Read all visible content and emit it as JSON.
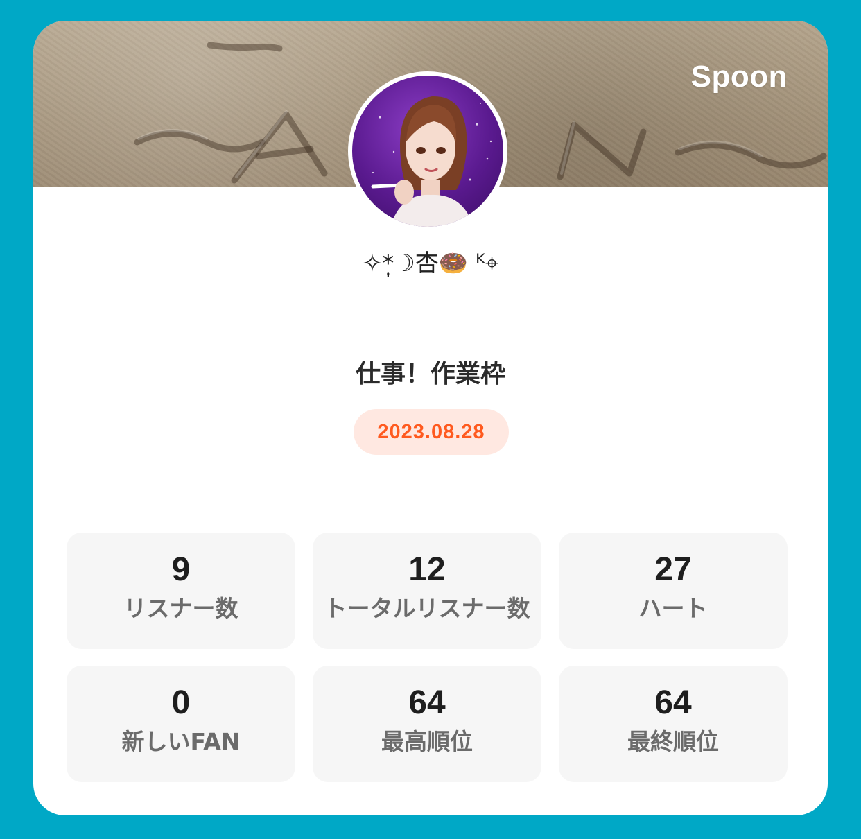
{
  "brand": {
    "name": "Spoon"
  },
  "profile": {
    "username": "✧*̣̩☽杏🍩 ᴷ⌖",
    "avatar_icon": "avatar-illustration"
  },
  "broadcast": {
    "title": "仕事！作業枠",
    "date": "2023.08.28"
  },
  "stats": [
    {
      "value": "9",
      "label": "リスナー数"
    },
    {
      "value": "12",
      "label": "トータルリスナー数"
    },
    {
      "value": "27",
      "label": "ハート"
    },
    {
      "value": "0",
      "label": "新しいFAN"
    },
    {
      "value": "64",
      "label": "最高順位"
    },
    {
      "value": "64",
      "label": "最終順位"
    }
  ],
  "colors": {
    "background": "#00a8c6",
    "card": "#ffffff",
    "date_text": "#ff5a1f",
    "date_pill": "#ffe8e1",
    "stat_tile": "#f6f6f6"
  }
}
